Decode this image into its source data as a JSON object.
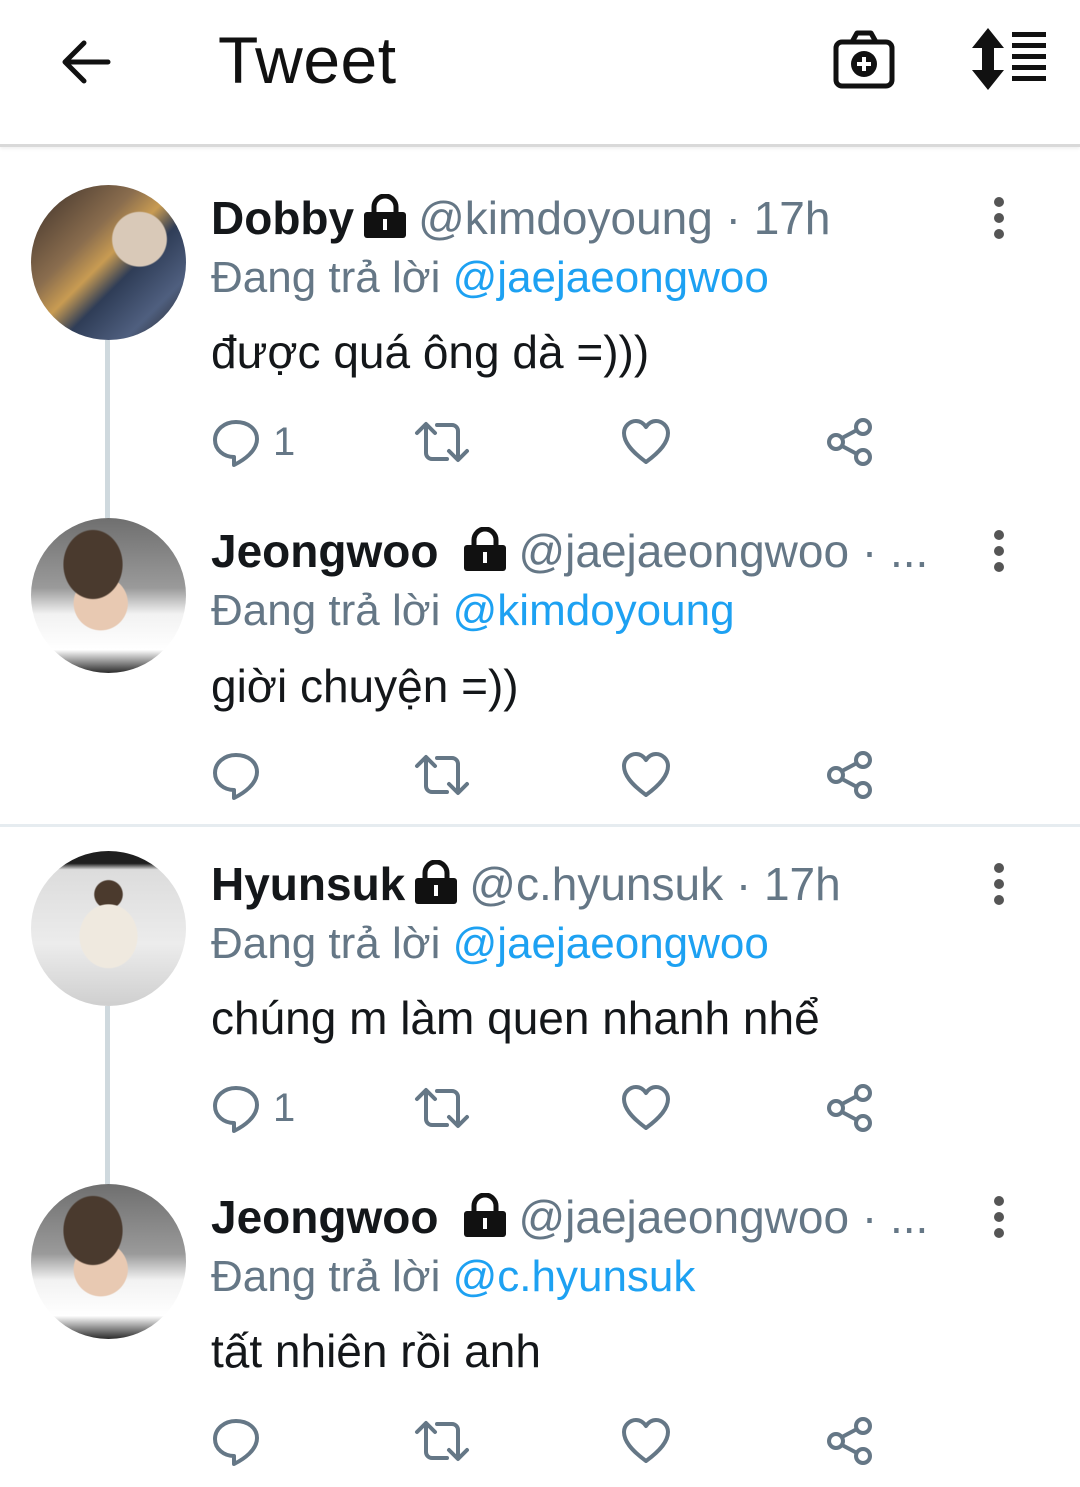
{
  "header": {
    "title": "Tweet",
    "back_icon": "arrow-left-icon",
    "camera_icon": "camera-plus-icon",
    "sort_icon": "sort-list-icon"
  },
  "reply_prefix": "Đang trả lời",
  "tweets": [
    {
      "name": "Dobby",
      "handle": "@kimdoyoung",
      "time_sep": " · 17h",
      "reply_to": "@kimdoyoung_reply",
      "reply_mention": "@jaejaeongwoo",
      "text": "được quá ông dà =)))",
      "reply_count": "1"
    },
    {
      "name": "Jeongwoo",
      "handle": "@jaejaeongwoo",
      "time_sep": " · ...",
      "reply_mention": "@kimdoyoung",
      "text": "giời chuyện =))",
      "reply_count": ""
    },
    {
      "name": "Hyunsuk",
      "handle": "@c.hyunsuk",
      "time_sep": " · 17h",
      "reply_mention": "@jaejaeongwoo",
      "text": "chúng m làm quen nhanh nhể",
      "reply_count": "1"
    },
    {
      "name": "Jeongwoo",
      "handle": "@jaejaeongwoo",
      "time_sep": " · ...",
      "reply_mention": "@c.hyunsuk",
      "text": "tất nhiên rồi anh",
      "reply_count": ""
    }
  ],
  "colors": {
    "accent": "#1da1f2",
    "secondary_text": "#657786",
    "primary_text": "#14171a"
  }
}
